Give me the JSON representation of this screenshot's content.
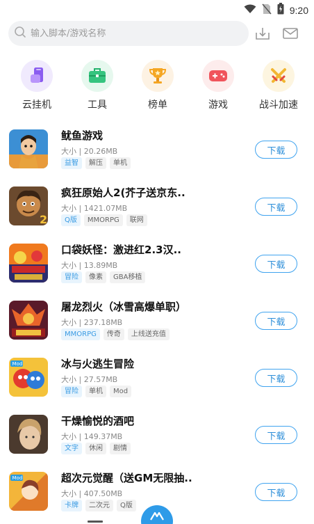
{
  "status_bar": {
    "time": "9:20",
    "icons": [
      "wifi-icon",
      "no-sim-icon",
      "battery-icon"
    ]
  },
  "search": {
    "placeholder": "输入脚本/游戏名称"
  },
  "categories": [
    {
      "label": "云挂机",
      "icon": "cloud-phone-icon",
      "bg": "#f0eafd"
    },
    {
      "label": "工具",
      "icon": "toolbox-icon",
      "bg": "#e6f8ee"
    },
    {
      "label": "榜单",
      "icon": "trophy-icon",
      "bg": "#fdf2e3"
    },
    {
      "label": "游戏",
      "icon": "gamepad-icon",
      "bg": "#fdecec"
    },
    {
      "label": "战斗加速",
      "icon": "swords-icon",
      "bg": "#fdf5e0"
    }
  ],
  "download_label": "下载",
  "games": [
    {
      "title": "鱿鱼游戏",
      "size": "大小 | 20.26MB",
      "tags": [
        "益智",
        "解压",
        "单机"
      ]
    },
    {
      "title": "疯狂原始人2(芥子送京东..",
      "size": "大小 | 1421.07MB",
      "tags": [
        "Q版",
        "MMORPG",
        "联网"
      ]
    },
    {
      "title": "口袋妖怪：激进红2.3汉..",
      "size": "大小 | 13.89MB",
      "tags": [
        "冒险",
        "像素",
        "GBA移植"
      ]
    },
    {
      "title": "屠龙烈火（冰雪高爆单职）",
      "size": "大小 | 237.18MB",
      "tags": [
        "MMORPG",
        "传奇",
        "上线送充值"
      ]
    },
    {
      "title": "冰与火逃生冒险",
      "size": "大小 | 27.57MB",
      "tags": [
        "冒险",
        "单机",
        "Mod"
      ]
    },
    {
      "title": "干燥愉悦的酒吧",
      "size": "大小 | 149.37MB",
      "tags": [
        "文字",
        "休闲",
        "剧情"
      ]
    },
    {
      "title": "超次元觉醒（送GM无限抽..",
      "size": "大小 | 407.50MB",
      "tags": [
        "卡牌",
        "二次元",
        "Q版"
      ]
    }
  ],
  "colors": {
    "accent": "#3fa3ef",
    "tag_primary_bg": "#e8f4fd",
    "tag_primary_text": "#3a9be3"
  }
}
